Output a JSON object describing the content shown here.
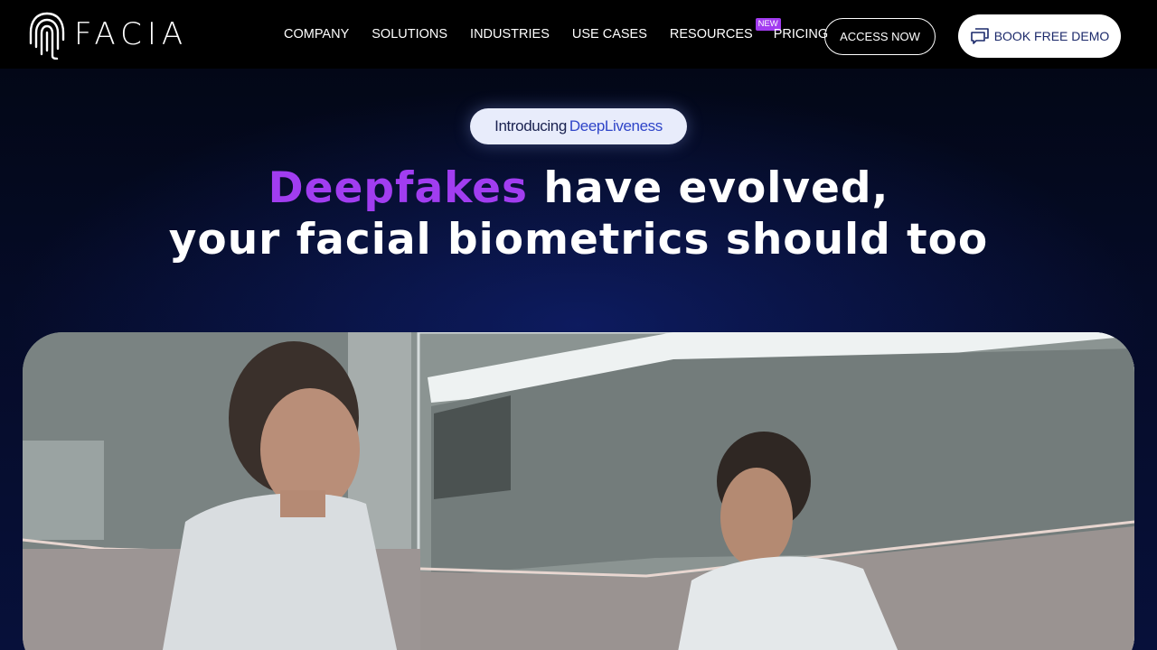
{
  "brand": {
    "name": "FACIA"
  },
  "nav": {
    "items": [
      {
        "label": "COMPANY"
      },
      {
        "label": "SOLUTIONS"
      },
      {
        "label": "INDUSTRIES"
      },
      {
        "label": "USE CASES"
      },
      {
        "label": "RESOURCES",
        "badge": "NEW"
      },
      {
        "label": "PRICING"
      }
    ],
    "access_label": "ACCESS NOW",
    "demo_label": "BOOK FREE DEMO",
    "demo_icon": "chat-bubbles-icon"
  },
  "hero": {
    "intro_prefix": "Introducing",
    "intro_highlight": "DeepLiveness",
    "headline_highlight": "Deepfakes",
    "headline_line1_rest": " have evolved,",
    "headline_line2": "your facial biometrics should too"
  },
  "colors": {
    "accent_purple": "#a13df0",
    "badge_purple": "#a23bf0",
    "demo_text": "#1c2a6b",
    "background": "#020510"
  }
}
